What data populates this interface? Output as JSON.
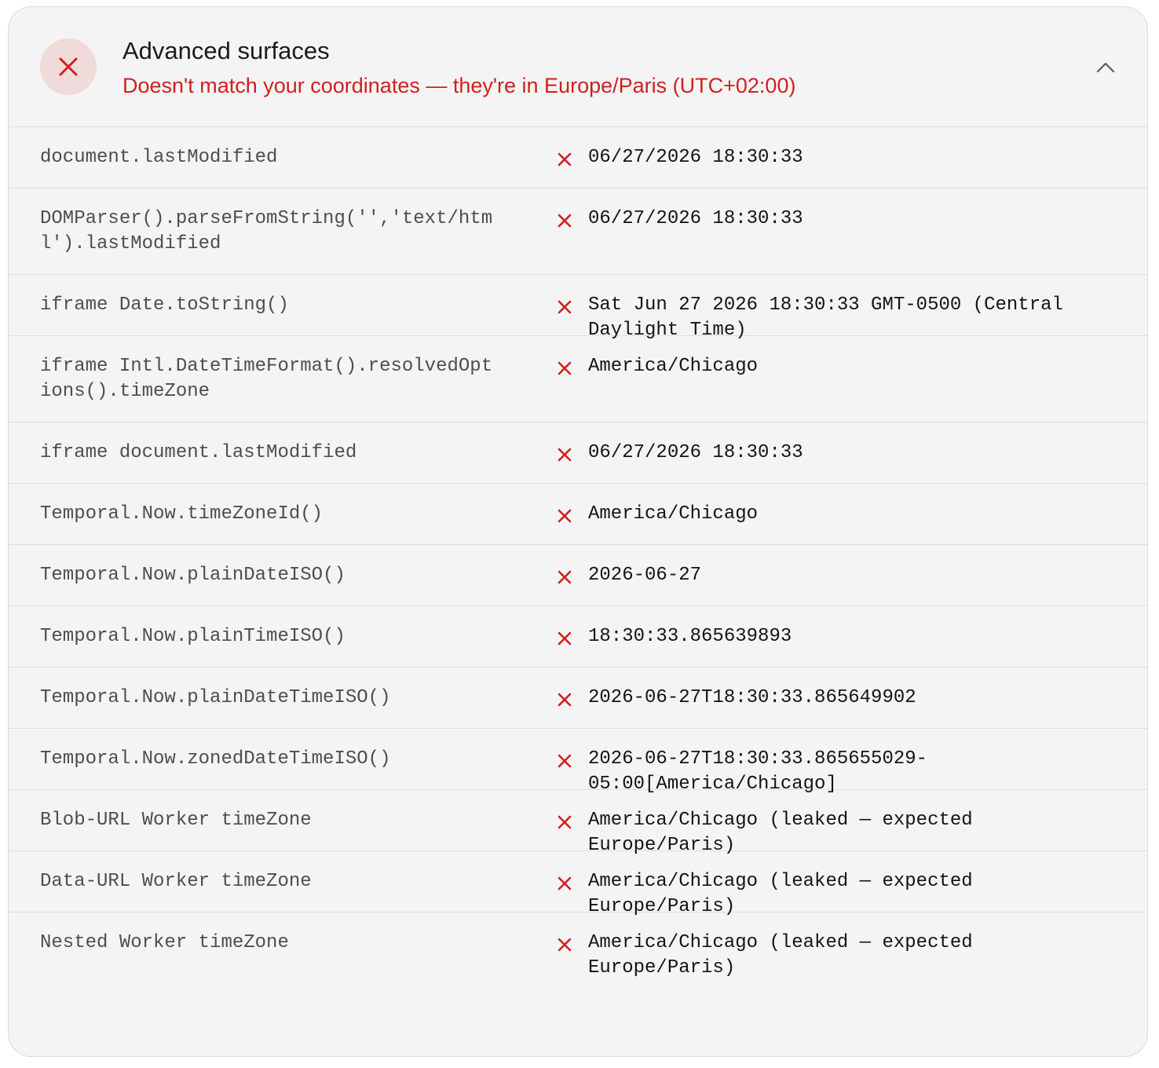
{
  "section": {
    "title": "Advanced surfaces",
    "subtitle": "Doesn't match your coordinates — they're in Europe/Paris (UTC+02:00)",
    "status_icon": "close-icon",
    "collapse_icon": "chevron-up-icon",
    "accent_color": "#d0201f",
    "status_bg_color": "#f1dada"
  },
  "rows": [
    {
      "label": "document.lastModified",
      "value": "06/27/2026 18:30:33",
      "status": "fail"
    },
    {
      "label": "DOMParser().parseFromString('','text/html').lastModified",
      "value": "06/27/2026 18:30:33",
      "status": "fail"
    },
    {
      "label": "iframe Date.toString()",
      "value": "Sat Jun 27 2026 18:30:33 GMT-0500 (Central Daylight Time)",
      "status": "fail"
    },
    {
      "label": "iframe Intl.DateTimeFormat().resolvedOptions().timeZone",
      "value": "America/Chicago",
      "status": "fail"
    },
    {
      "label": "iframe document.lastModified",
      "value": "06/27/2026 18:30:33",
      "status": "fail"
    },
    {
      "label": "Temporal.Now.timeZoneId()",
      "value": "America/Chicago",
      "status": "fail"
    },
    {
      "label": "Temporal.Now.plainDateISO()",
      "value": "2026-06-27",
      "status": "fail"
    },
    {
      "label": "Temporal.Now.plainTimeISO()",
      "value": "18:30:33.865639893",
      "status": "fail"
    },
    {
      "label": "Temporal.Now.plainDateTimeISO()",
      "value": "2026-06-27T18:30:33.865649902",
      "status": "fail"
    },
    {
      "label": "Temporal.Now.zonedDateTimeISO()",
      "value": "2026-06-27T18:30:33.865655029-05:00[America/Chicago]",
      "status": "fail"
    },
    {
      "label": "Blob-URL Worker timeZone",
      "value": "America/Chicago (leaked — expected Europe/Paris)",
      "status": "fail"
    },
    {
      "label": "Data-URL Worker timeZone",
      "value": "America/Chicago (leaked — expected Europe/Paris)",
      "status": "fail"
    },
    {
      "label": "Nested Worker timeZone",
      "value": "America/Chicago (leaked — expected Europe/Paris)",
      "status": "fail"
    }
  ]
}
